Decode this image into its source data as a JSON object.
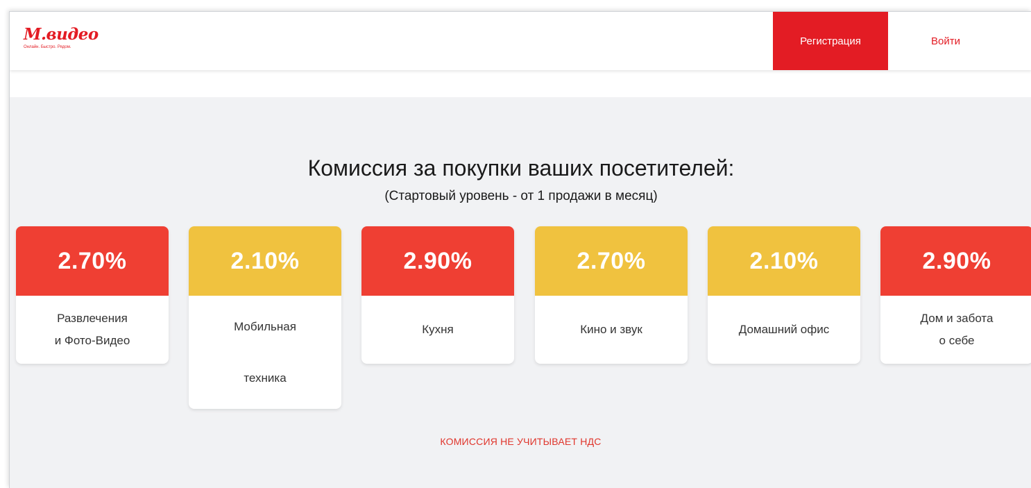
{
  "header": {
    "logo_text": "М.видео",
    "logo_tagline": "Онлайн. Быстро. Рядом.",
    "register_label": "Регистрация",
    "login_label": "Войти"
  },
  "main": {
    "title": "Комиссия за покупки ваших посетителей:",
    "subtitle": "(Стартовый уровень - от 1 продажи в месяц)",
    "cards": [
      {
        "rate": "2.70%",
        "label_line1": "Развлечения",
        "label_line2": "и Фото-Видео",
        "color": "#ef3f33"
      },
      {
        "rate": "2.10%",
        "label_line1": "Мобильная",
        "label_line2": "техника",
        "color": "#f0c23f"
      },
      {
        "rate": "2.90%",
        "label_line1": "Кухня",
        "label_line2": "",
        "color": "#ef3f33"
      },
      {
        "rate": "2.70%",
        "label_line1": "Кино и звук",
        "label_line2": "",
        "color": "#f0c23f"
      },
      {
        "rate": "2.10%",
        "label_line1": "Домашний офис",
        "label_line2": "",
        "color": "#f0c23f"
      },
      {
        "rate": "2.90%",
        "label_line1": "Дом и забота",
        "label_line2": "о себе",
        "color": "#ef3f33"
      }
    ],
    "vat_note": "КОМИССИЯ НЕ УЧИТЫВАЕТ НДС"
  },
  "colors": {
    "brand_red": "#e31c24",
    "card_red": "#ef3f33",
    "card_yellow": "#f0c23f",
    "page_background": "#f1f2f4"
  }
}
